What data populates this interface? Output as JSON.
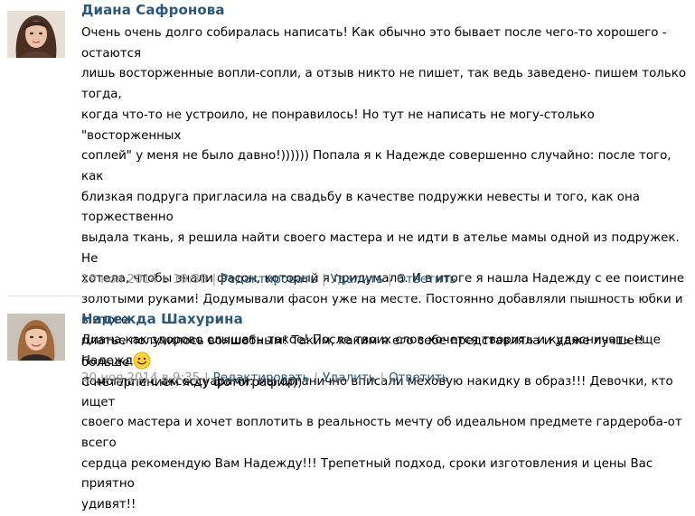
{
  "comments": [
    {
      "author": "Диана Сафронова",
      "lines": [
        "Очень очень долго собиралась написать! Как обычно это бывает после чего-то хорошего - остаются",
        "лишь восторженные вопли-сопли, а отзыв никто не пишет, так ведь заведено- пишем только тогда,",
        "когда что-то не устроило, не понравилось! Но тут не написать не могу-столько \"восторженных",
        "соплей\" у меня не было давно!)))))) Попала я к Надежде совершенно случайно: после того, как",
        "близкая подруга пригласила на свадьбу в качестве подружки невесты и того, как она торжественно",
        "выдала ткань, я решила найти своего мастера и не идти в ателье мамы одной из подружек. Не",
        "хотела, чтобы знали фасон, который я придумала. И в итоге я нашла Надежду с ее поистине",
        "золотыми руками! Додумывали фасон уже на месте. Постоянно добавляли пышность юбки и в итоге",
        "платье получилось волшебным! Таким, каким я его себе представляла и даже лучше!! Надежда",
        "помогла и с аксессуарами: мы органично вписали меховую накидку в образ!!! Девочки, кто ищет",
        "своего мастера и хочет воплотить в реальность мечту об идеальном предмете гардероба-от всего",
        "сердца рекомендую Вам Надежду!!! Трепетный подход, сроки изготовления и цены Вас приятно",
        "удивят!!"
      ],
      "date": "19 ноя 2014 в 19:38",
      "actions": {
        "edit": "Редактировать",
        "delete": "Удалить",
        "reply": "Ответить"
      },
      "separator": "|"
    },
    {
      "author": "Надежда Шахурина",
      "lines": [
        "Диана,как здорово слышать такое! После твоих слов хочется творить и кудесничать еще больше",
        "С нетерпением жду фотографии))"
      ],
      "date": "20 ноя 2014 в 9:35",
      "actions": {
        "edit": "Редактировать",
        "delete": "Удалить",
        "reply": "Ответить"
      },
      "separator": "|"
    }
  ],
  "colors": {
    "author": "#2b587a",
    "link": "#2b587a",
    "meta": "#999999"
  },
  "icons": {
    "emoji": "smiley-face-icon"
  }
}
